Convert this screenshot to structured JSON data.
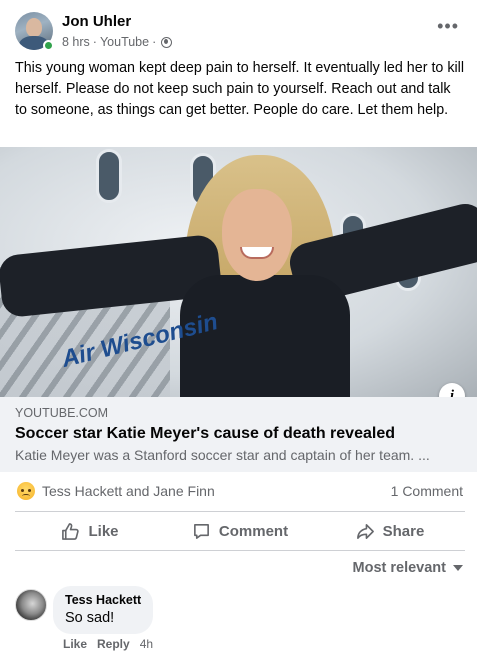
{
  "post": {
    "author": "Jon Uhler",
    "time": "8 hrs",
    "source": "YouTube",
    "separator": "·",
    "more_label": "•••",
    "text": "This young woman kept deep pain to herself. It eventually led her to kill herself. Please do not keep such pain to yourself. Reach out and talk to someone, as things can get better. People do care. Let them help."
  },
  "link": {
    "image_text": "Air Wisconsin",
    "info_label": "i",
    "domain": "YOUTUBE.COM",
    "title": "Soccer star Katie Meyer's cause of death revealed",
    "description": "Katie Meyer was a Stanford soccer star and captain of her team. ..."
  },
  "reactions": {
    "icon": "sad-reaction",
    "names": "Tess Hackett and Jane Finn",
    "comment_count": "1 Comment"
  },
  "actions": {
    "like": "Like",
    "comment": "Comment",
    "share": "Share"
  },
  "sort": {
    "label": "Most relevant"
  },
  "comment": {
    "author": "Tess Hackett",
    "text": "So sad!",
    "like": "Like",
    "reply": "Reply",
    "time": "4h"
  },
  "colors": {
    "secondary_text": "#65676b",
    "bubble_bg": "#f0f2f5",
    "online": "#31a24c"
  }
}
